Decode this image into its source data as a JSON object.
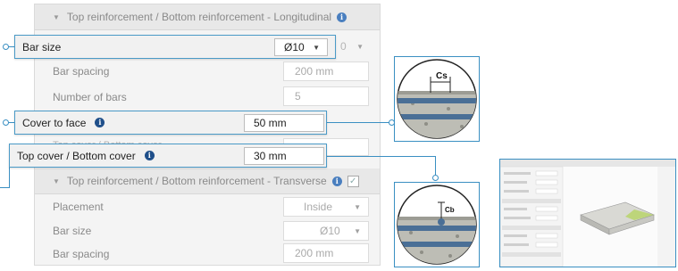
{
  "longitudinal": {
    "title": "Top reinforcement / Bottom reinforcement - Longitudinal",
    "bar_size_ghost_value": "0",
    "bar_spacing_label": "Bar spacing",
    "bar_spacing_value": "200 mm",
    "number_of_bars_label": "Number of bars",
    "number_of_bars_value": "5",
    "ghost_row_label": "Top cover / Bottom cover"
  },
  "transverse": {
    "title": "Top reinforcement / Bottom reinforcement - Transverse",
    "placement_label": "Placement",
    "placement_value": "Inside",
    "bar_size_label": "Bar size",
    "bar_size_value": "Ø10",
    "bar_spacing_label": "Bar spacing",
    "bar_spacing_value": "200 mm"
  },
  "callouts": {
    "bar_size_label": "Bar size",
    "bar_size_value": "Ø10",
    "cover_to_face_label": "Cover to face",
    "cover_to_face_value": "50 mm",
    "top_cover_label": "Top cover / Bottom cover",
    "top_cover_value": "30 mm"
  },
  "detail": {
    "cs_label": "Cs",
    "cb_label": "Cb"
  },
  "colors": {
    "accent": "#3a8fc2",
    "info_icon": "#1f4f8a",
    "rebar": "#4a6f96",
    "concrete": "#bdbdb5"
  },
  "icons": [
    "info-icon",
    "dropdown-chevron-icon",
    "collapse-chevron-icon",
    "checkbox-icon"
  ]
}
